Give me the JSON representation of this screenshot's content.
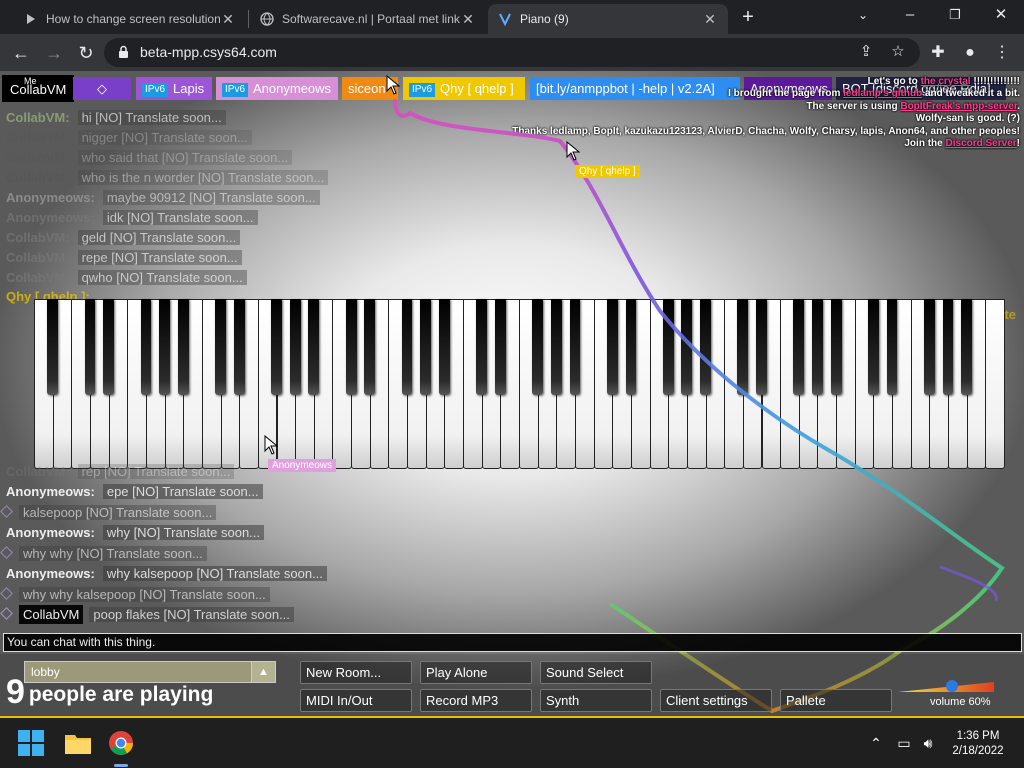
{
  "browser": {
    "tabs": [
      {
        "title": "How to change screen resolution",
        "active": false
      },
      {
        "title": "Softwarecave.nl | Portaal met link",
        "active": false
      },
      {
        "title": "Piano (9)",
        "active": true
      }
    ],
    "url": "beta-mpp.csys64.com",
    "icons": [
      "back-icon",
      "forward-icon",
      "reload-icon",
      "lock-icon",
      "share-icon",
      "star-icon",
      "extensions-icon",
      "profile-icon",
      "menu-icon"
    ]
  },
  "users": {
    "me_label": "Me",
    "me_name": "CollabVM",
    "tags": [
      {
        "name": "◇",
        "color": "#7a3fc9",
        "ipv6": false
      },
      {
        "name": "Lapis",
        "color": "#9b55d6",
        "ipv6": true,
        "ipv6_label": "IPv6"
      },
      {
        "name": "Anonymeows",
        "color": "#d78fd6",
        "ipv6": true,
        "ipv6_label": "IPv6"
      },
      {
        "name": "siceon",
        "color": "#f08a12",
        "ipv6": false
      },
      {
        "name": "Qhy [ qhelp ]",
        "color": "#f0c800",
        "ipv6": true,
        "ipv6_label": "IPv6"
      },
      {
        "name": "[bit.ly/anmppbot | -help | v2.2A]",
        "color": "#2e8df0",
        "ipv6": false
      },
      {
        "name": "Anonymeows",
        "color": "#5a1a9a",
        "ipv6": false
      },
      {
        "name": "BOT [discord.gg/jee.Rdia]",
        "color": "#222244",
        "ipv6": false
      }
    ]
  },
  "credits": {
    "line1_pre": "Let's go to ",
    "line1_link": "the crystal",
    "line1_post": " !!!!!!!!!!!!!!",
    "line2_pre": "I brought the page from ",
    "line2_link": "ledlamp's github",
    "line2_post": " and tweaked it a bit.",
    "line3_pre": "The server is using ",
    "line3_link": "BopItFreak's mpp-server",
    "line3_post": ".",
    "line4": "Wolfy-san is good. (?)",
    "line5": "Thanks ledlamp, BopIt, kazukazu123123, AlvierD, Chacha, Wolfy, Charsy, lapis, Anon64, and other peoples!",
    "line6_pre": "Join the ",
    "line6_link": "Discord Server",
    "line6_post": "!"
  },
  "chat": {
    "messages_top": [
      {
        "name": "CollabVM:",
        "text": "hi [NO] Translate soon...",
        "color": "#9ab07a"
      },
      {
        "name": "CollabVM:",
        "text": "nigger [NO] Translate soon...",
        "color": "#7a7a7a"
      },
      {
        "name": "CollabVM:",
        "text": "who said that [NO] Translate soon...",
        "color": "#7a7a7a"
      },
      {
        "name": "CollabVM:",
        "text": "who is the n worder [NO] Translate soon...",
        "color": "#7a7a7a"
      },
      {
        "name": "Anonymeows:",
        "text": "maybe 90912 [NO] Translate soon...",
        "color": "#aaaaaa"
      },
      {
        "name": "Anonymeows:",
        "text": "idk [NO] Translate soon...",
        "color": "#8a8a8a"
      },
      {
        "name": "CollabVM:",
        "text": "geld [NO] Translate soon...",
        "color": "#8a8a8a"
      },
      {
        "name": "CollabVM:",
        "text": "repe [NO] Translate soon...",
        "color": "#8a8a8a"
      },
      {
        "name": "CollabVM:",
        "text": "qwho [NO] Translate soon...",
        "color": "#8a8a8a"
      }
    ],
    "partial_left": "Qhy [ qhelp ]:",
    "partial_right": "te",
    "messages_bottom": [
      {
        "name": "CollabVM:",
        "text": "rep [NO] Translate soon...",
        "style": "faded"
      },
      {
        "name": "Anonymeows:",
        "text": "epe [NO] Translate soon...",
        "style": "bold"
      },
      {
        "name": "",
        "text": "kalsepoop [NO] Translate soon...",
        "style": "diamond"
      },
      {
        "name": "Anonymeows:",
        "text": "why [NO] Translate soon...",
        "style": "bold"
      },
      {
        "name": "",
        "text": "why why [NO] Translate soon...",
        "style": "diamond"
      },
      {
        "name": "Anonymeows:",
        "text": "why kalsepoop [NO] Translate soon...",
        "style": "bold"
      },
      {
        "name": "",
        "text": "why why kalsepoop [NO] Translate soon...",
        "style": "diamond"
      },
      {
        "name": "CollabVM",
        "text": "poop flakes [NO] Translate soon...",
        "style": "tag"
      }
    ],
    "input_placeholder": "You can chat with this thing."
  },
  "cursors": {
    "qhy_label": "Qhy [ qhelp ]",
    "anon_label": "Anonymeows"
  },
  "room": {
    "name": "lobby",
    "players_count": "9",
    "players_text": "people are playing"
  },
  "buttons": {
    "new_room": "New Room...",
    "play_alone": "Play Alone",
    "sound_select": "Sound Select",
    "midi": "MIDI In/Out",
    "record": "Record MP3",
    "synth": "Synth",
    "client_settings": "Client settings",
    "pallete": "Pallete"
  },
  "volume": {
    "label": "volume 60%",
    "level": 0.6
  },
  "taskbar": {
    "time": "1:36 PM",
    "date": "2/18/2022"
  },
  "colors": {
    "accent_yellow": "#e6c200",
    "chrome_dark": "#202124",
    "chrome_toolbar": "#35363a"
  }
}
